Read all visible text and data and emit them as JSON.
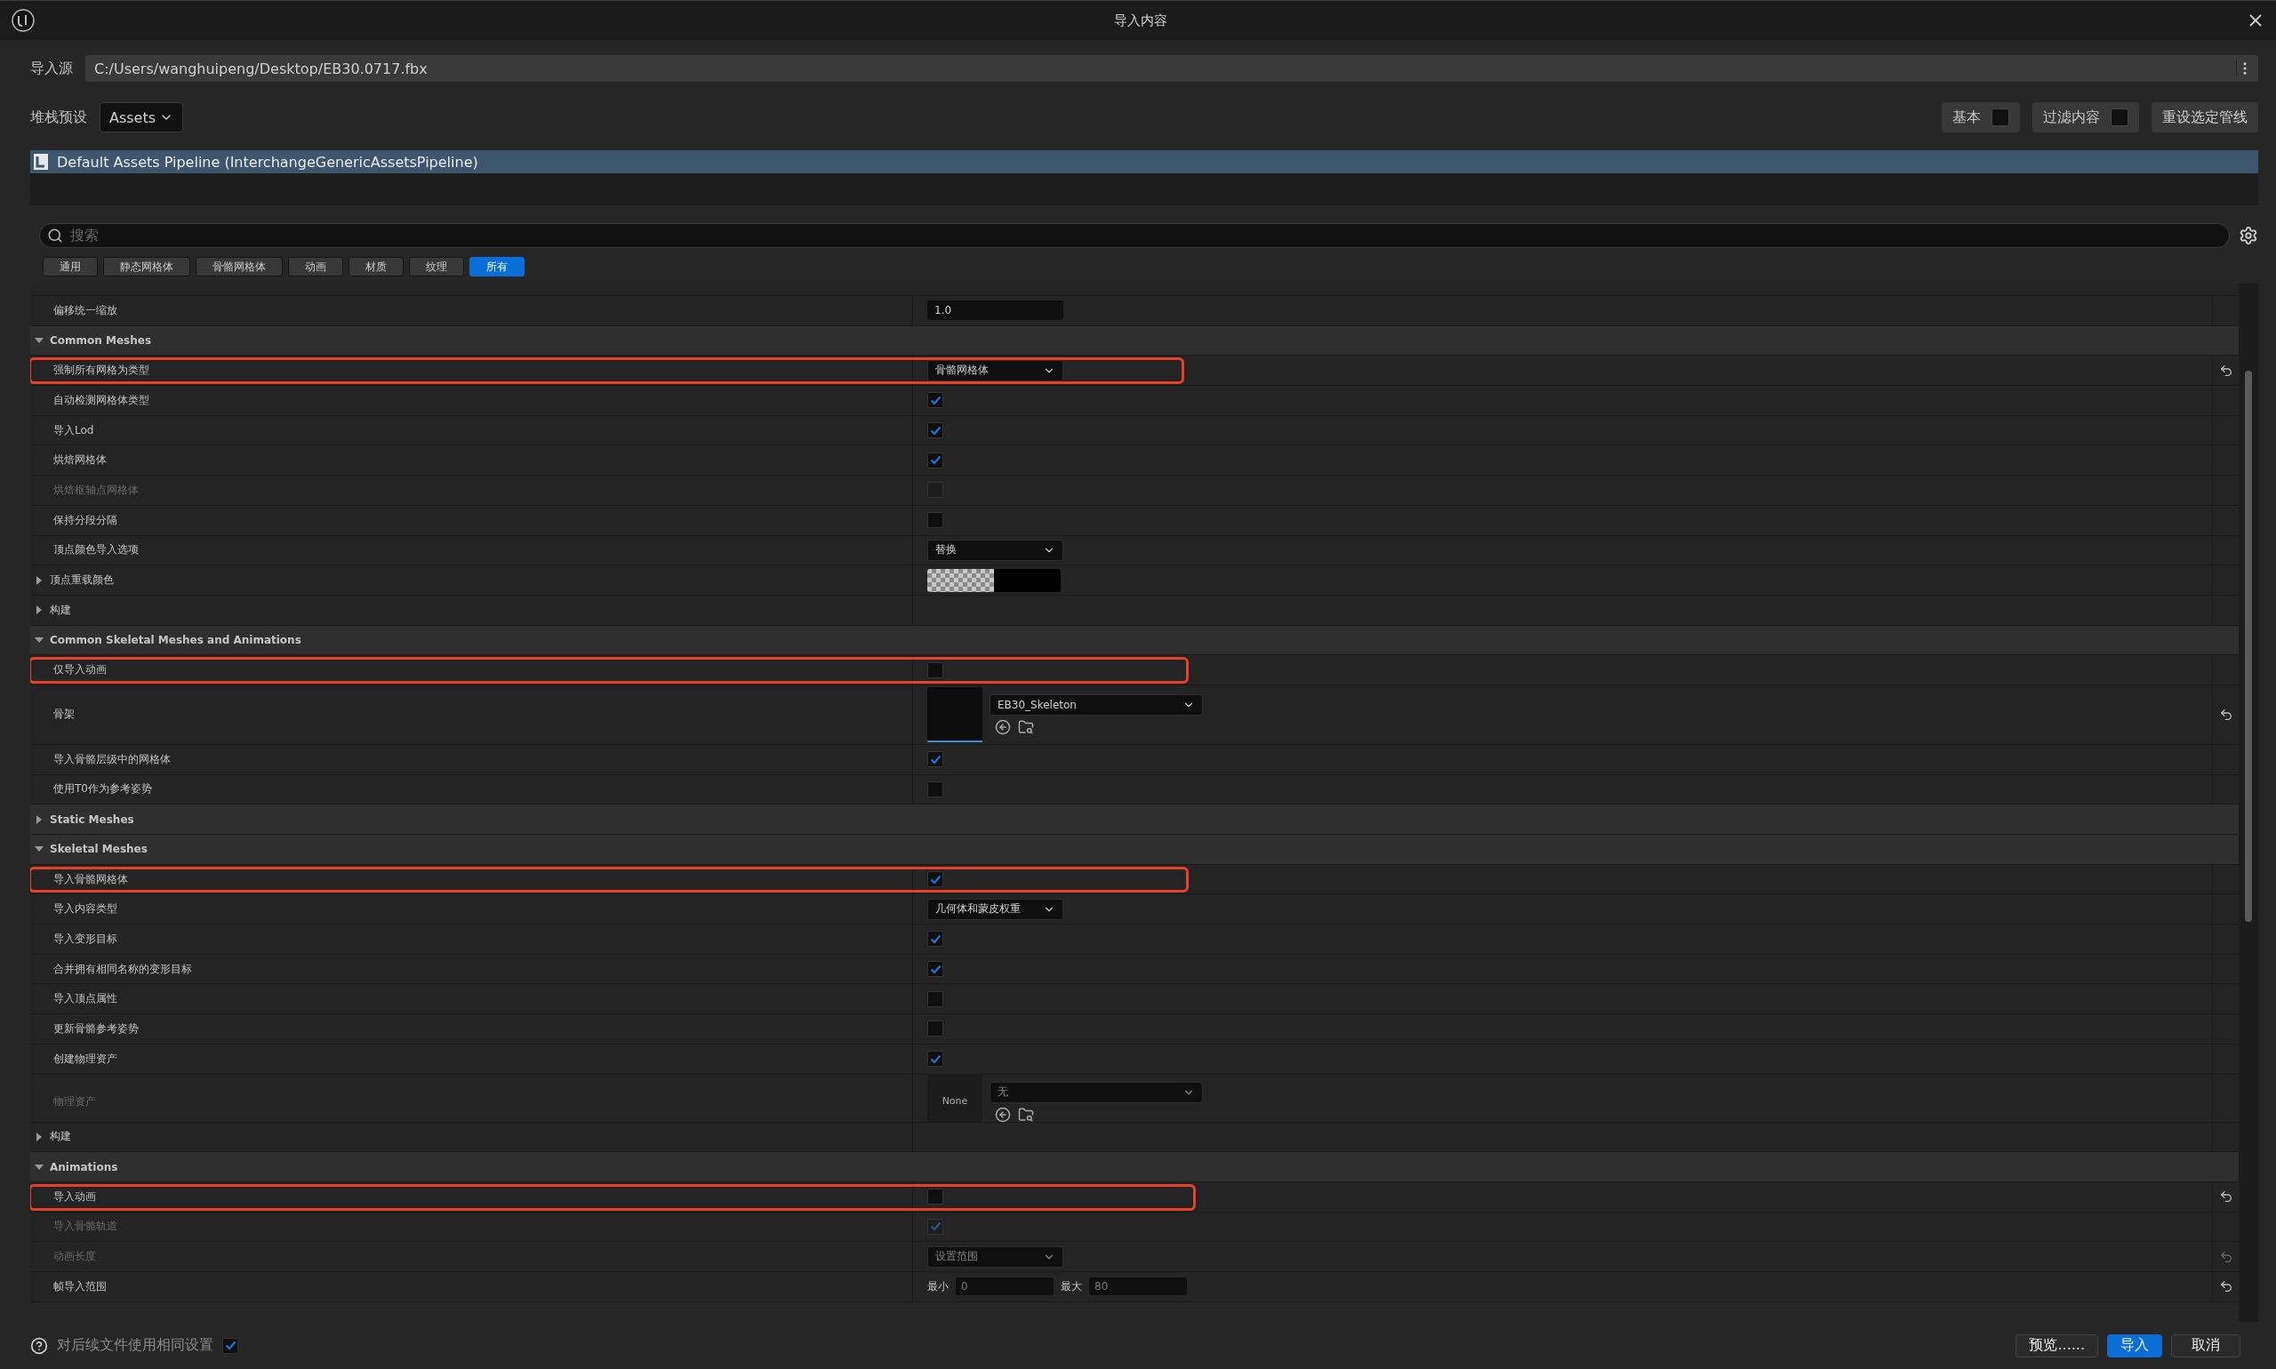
{
  "window": {
    "title": "导入内容"
  },
  "source": {
    "label": "导入源",
    "value": "C:/Users/wanghuipeng/Desktop/EB30.0717.fbx"
  },
  "preset": {
    "label": "堆栈预设",
    "value": "Assets"
  },
  "toggles": [
    {
      "label": "基本",
      "checked": false
    },
    {
      "label": "过滤内容",
      "checked": false
    }
  ],
  "reset_button": "重设选定管线",
  "pipeline": {
    "name": "Default Assets Pipeline (InterchangeGenericAssetsPipeline)"
  },
  "search": {
    "placeholder": "搜索"
  },
  "filter_tabs": [
    {
      "label": "通用",
      "selected": false
    },
    {
      "label": "静态网格体",
      "selected": false
    },
    {
      "label": "骨骼网格体",
      "selected": false
    },
    {
      "label": "动画",
      "selected": false
    },
    {
      "label": "材质",
      "selected": false
    },
    {
      "label": "纹理",
      "selected": false
    },
    {
      "label": "所有",
      "selected": true
    }
  ],
  "rows": [
    {
      "kind": "text",
      "label": "偏移统一缩放",
      "value": "1.0"
    },
    {
      "kind": "header",
      "label": "Common Meshes",
      "expanded": true
    },
    {
      "kind": "dropdown",
      "label": "强制所有网格为类型",
      "value": "骨骼网格体",
      "highlighted": true,
      "reset": true
    },
    {
      "kind": "checkbox",
      "label": "自动检测网格体类型",
      "checked": true
    },
    {
      "kind": "checkbox",
      "label": "导入Lod",
      "checked": true
    },
    {
      "kind": "checkbox",
      "label": "烘焙网格体",
      "checked": true
    },
    {
      "kind": "checkbox",
      "label": "烘焙枢轴点网格体",
      "checked": false,
      "disabled": true
    },
    {
      "kind": "checkbox",
      "label": "保持分段分隔",
      "checked": false
    },
    {
      "kind": "dropdown",
      "label": "顶点颜色导入选项",
      "value": "替换"
    },
    {
      "kind": "color",
      "label": "顶点重载颜色",
      "expanded": false
    },
    {
      "kind": "group",
      "label": "构建",
      "expanded": false
    },
    {
      "kind": "header",
      "label": "Common Skeletal Meshes and Animations",
      "expanded": true
    },
    {
      "kind": "checkbox",
      "label": "仅导入动画",
      "checked": false,
      "highlighted": true
    },
    {
      "kind": "asset",
      "label": "骨架",
      "value": "EB30_Skeleton",
      "reset": true
    },
    {
      "kind": "checkbox",
      "label": "导入骨骼层级中的网格体",
      "checked": true
    },
    {
      "kind": "checkbox",
      "label": "使用T0作为参考姿势",
      "checked": false
    },
    {
      "kind": "header",
      "label": "Static Meshes",
      "expanded": false
    },
    {
      "kind": "header",
      "label": "Skeletal Meshes",
      "expanded": true
    },
    {
      "kind": "checkbox",
      "label": "导入骨骼网格体",
      "checked": true,
      "highlighted": true
    },
    {
      "kind": "dropdown",
      "label": "导入内容类型",
      "value": "几何体和蒙皮权重"
    },
    {
      "kind": "checkbox",
      "label": "导入变形目标",
      "checked": true
    },
    {
      "kind": "checkbox",
      "label": "合并拥有相同名称的变形目标",
      "checked": true
    },
    {
      "kind": "checkbox",
      "label": "导入顶点属性",
      "checked": false
    },
    {
      "kind": "checkbox",
      "label": "更新骨骼参考姿势",
      "checked": false
    },
    {
      "kind": "checkbox",
      "label": "创建物理资产",
      "checked": true
    },
    {
      "kind": "asset",
      "label": "物理资产",
      "value": "无",
      "thumbnail": "None",
      "disabled": true
    },
    {
      "kind": "group",
      "label": "构建",
      "expanded": false
    },
    {
      "kind": "header",
      "label": "Animations",
      "expanded": true
    },
    {
      "kind": "checkbox",
      "label": "导入动画",
      "checked": false,
      "highlighted": true,
      "reset": true
    },
    {
      "kind": "checkbox",
      "label": "导入骨骼轨道",
      "checked": true,
      "disabled": true
    },
    {
      "kind": "dropdown",
      "label": "动画长度",
      "value": "设置范围",
      "disabled": true,
      "reset": true
    },
    {
      "kind": "range",
      "label": "帧导入范围",
      "min_label": "最小",
      "min": "0",
      "max_label": "最大",
      "max": "80",
      "reset": true
    }
  ],
  "footer": {
    "label": "对后续文件使用相同设置",
    "checked": true,
    "buttons": [
      {
        "label": "预览......",
        "primary": false
      },
      {
        "label": "导入",
        "primary": true
      },
      {
        "label": "取消",
        "primary": false
      }
    ]
  }
}
